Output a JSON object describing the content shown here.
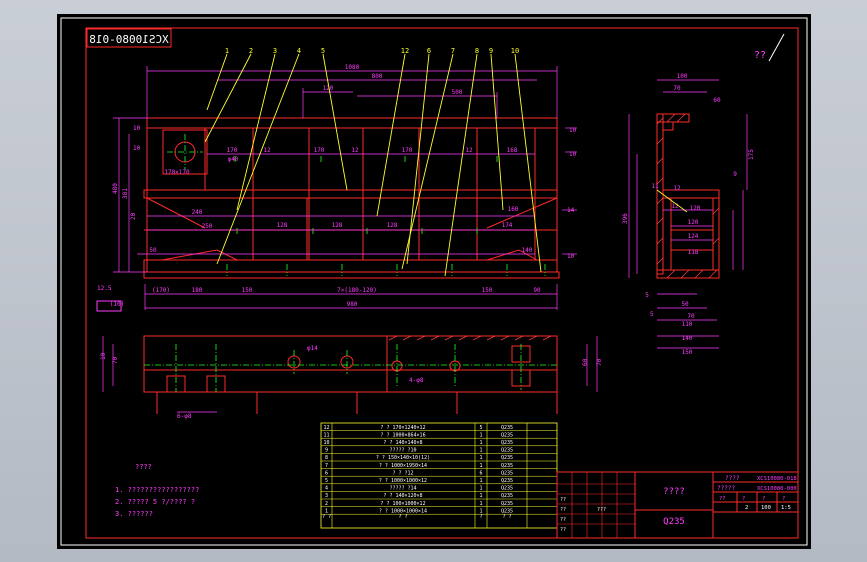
{
  "drawing_number": "XCS10080-018",
  "corner_mark": "??",
  "view_main": {
    "top_dims": [
      "1080",
      "800",
      "120",
      "500"
    ],
    "col_dims": [
      "170",
      "12",
      "170",
      "12",
      "170",
      "12",
      "168"
    ],
    "col_dims_row2": [
      "240",
      "128",
      "128",
      "128",
      "174"
    ],
    "col_dims_row3": [
      "250",
      "150"
    ],
    "left_dims": [
      "10",
      "10",
      "480",
      "381",
      "20",
      "50",
      "12.5"
    ],
    "right_dims": [
      "10",
      "10",
      "14",
      "160",
      "10",
      "140",
      "10"
    ],
    "bottom_dims": [
      "(170)",
      "180",
      "150",
      "7×(180-120)",
      "150",
      "90",
      "980"
    ],
    "hole_label": "φ40",
    "box_label": "170×170",
    "bottom_left_label": "10",
    "phi_label": "φ8",
    "bottom_callout": "(10)"
  },
  "view_side": {
    "dims": [
      "100",
      "70",
      "60",
      "175",
      "396",
      "9",
      "12",
      "12",
      "120",
      "120",
      "124",
      "118",
      "5",
      "5",
      "50",
      "70",
      "110",
      "140",
      "150"
    ],
    "callout": "11"
  },
  "view_plan": {
    "left_dims": [
      "10",
      "70",
      "70"
    ],
    "right_dims": [
      "60",
      "70",
      "100"
    ],
    "label1": "φ14",
    "label2": "4-φ8",
    "label3": "6-φ8"
  },
  "part_callouts": [
    "1",
    "2",
    "3",
    "4",
    "5",
    "12",
    "6",
    "7",
    "8",
    "9",
    "10"
  ],
  "bom": {
    "rows": [
      {
        "no": "12",
        "name": "? ? 170×1240×12",
        "qty": "5",
        "mat": "Q235"
      },
      {
        "no": "11",
        "name": "? ? 1000×864×16",
        "qty": "1",
        "mat": "Q235"
      },
      {
        "no": "10",
        "name": "? ? 140×140×8",
        "qty": "1",
        "mat": "Q235"
      },
      {
        "no": "9",
        "name": "????? ?10",
        "qty": "1",
        "mat": "Q235"
      },
      {
        "no": "8",
        "name": "? ? 150×140×10(12)",
        "qty": "1",
        "mat": "Q235"
      },
      {
        "no": "7",
        "name": "? ? 1000×1950×14",
        "qty": "1",
        "mat": "Q235"
      },
      {
        "no": "6",
        "name": "? ? ?12",
        "qty": "6",
        "mat": "Q235"
      },
      {
        "no": "5",
        "name": "? ? 1000×1000×12",
        "qty": "1",
        "mat": "Q235"
      },
      {
        "no": "4",
        "name": "????? ?14",
        "qty": "1",
        "mat": "Q235"
      },
      {
        "no": "3",
        "name": "? ? 140×120×8",
        "qty": "1",
        "mat": "Q235"
      },
      {
        "no": "2",
        "name": "? ? 100×1000×12",
        "qty": "1",
        "mat": "Q235"
      },
      {
        "no": "1",
        "name": "? ? 1000×1000×14",
        "qty": "1",
        "mat": "Q235"
      }
    ],
    "header": [
      "? ?",
      "? ?",
      "?",
      "? ?"
    ]
  },
  "notes": {
    "title": "????",
    "items": [
      "1. ?????????????????",
      "2. ????? 5 ?/???? ?",
      "3. ??????"
    ]
  },
  "title_block": {
    "name": "????",
    "material": "Q235",
    "number1": "XCS10080-018",
    "number2": "XCS10080-000",
    "label_top": "????",
    "label_right": "?????",
    "scale_cells": [
      "??",
      "?",
      "?",
      "?"
    ],
    "small_nums": [
      "2",
      "100",
      "1:5"
    ],
    "mini": [
      "??",
      "??",
      "??",
      "??",
      "???"
    ]
  },
  "colors": {
    "outline": "#ff2a2a",
    "dim": "#ff3cff",
    "center": "#20ff20",
    "leader": "#ffff30",
    "hatch": "#ff4040",
    "text": "#ff3cff",
    "white": "#ffffff"
  }
}
